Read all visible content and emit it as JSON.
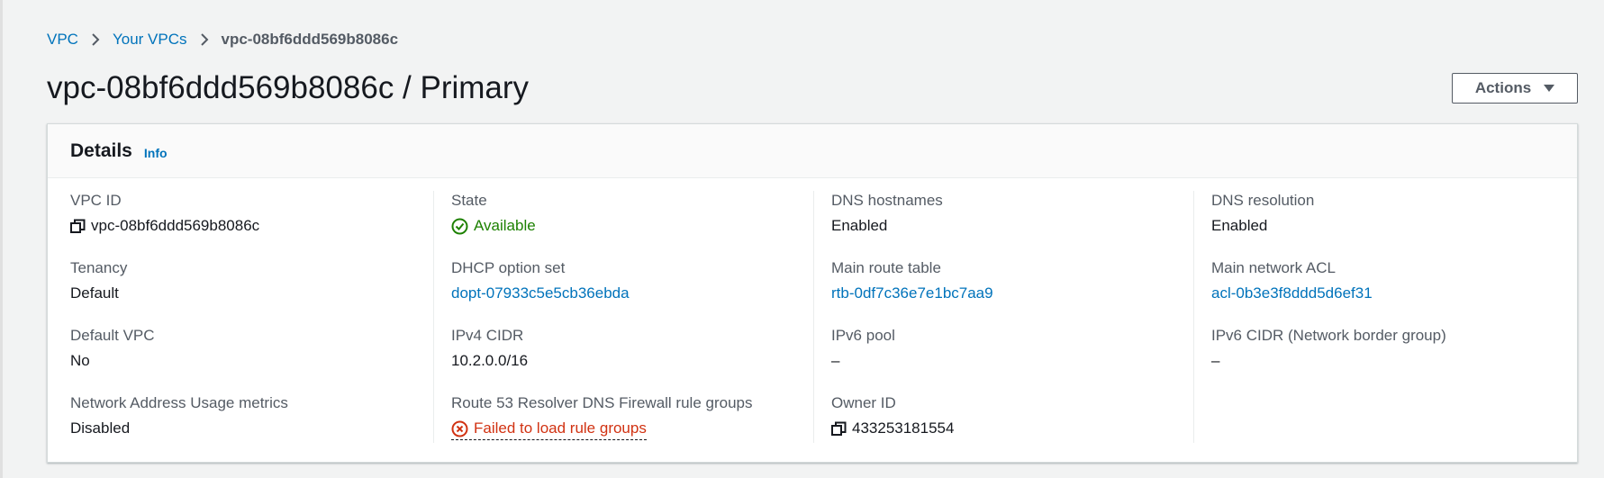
{
  "breadcrumb": {
    "items": [
      "VPC",
      "Your VPCs"
    ],
    "current": "vpc-08bf6ddd569b8086c"
  },
  "page_title": "vpc-08bf6ddd569b8086c / Primary",
  "actions_label": "Actions",
  "details": {
    "title": "Details",
    "info_label": "Info",
    "columns": [
      [
        {
          "label": "VPC ID",
          "value": "vpc-08bf6ddd569b8086c",
          "icon": "copy-icon"
        },
        {
          "label": "Tenancy",
          "value": "Default"
        },
        {
          "label": "Default VPC",
          "value": "No"
        },
        {
          "label": "Network Address Usage metrics",
          "value": "Disabled"
        }
      ],
      [
        {
          "label": "State",
          "value": "Available",
          "icon": "check-circle-icon"
        },
        {
          "label": "DHCP option set",
          "value": "dopt-07933c5e5cb36ebda"
        },
        {
          "label": "IPv4 CIDR",
          "value": "10.2.0.0/16"
        },
        {
          "label": "Route 53 Resolver DNS Firewall rule groups",
          "value": "Failed to load rule groups",
          "icon": "error-circle-icon"
        }
      ],
      [
        {
          "label": "DNS hostnames",
          "value": "Enabled"
        },
        {
          "label": "Main route table",
          "value": "rtb-0df7c36e7e1bc7aa9"
        },
        {
          "label": "IPv6 pool",
          "value": "–"
        },
        {
          "label": "Owner ID",
          "value": "433253181554",
          "icon": "copy-icon"
        }
      ],
      [
        {
          "label": "DNS resolution",
          "value": "Enabled"
        },
        {
          "label": "Main network ACL",
          "value": "acl-0b3e3f8ddd5d6ef31"
        },
        {
          "label": "IPv6 CIDR (Network border group)",
          "value": "–"
        }
      ]
    ]
  },
  "colors": {
    "link": "#0073bb",
    "success": "#1d8102",
    "error": "#d13212",
    "label": "#545b64"
  }
}
